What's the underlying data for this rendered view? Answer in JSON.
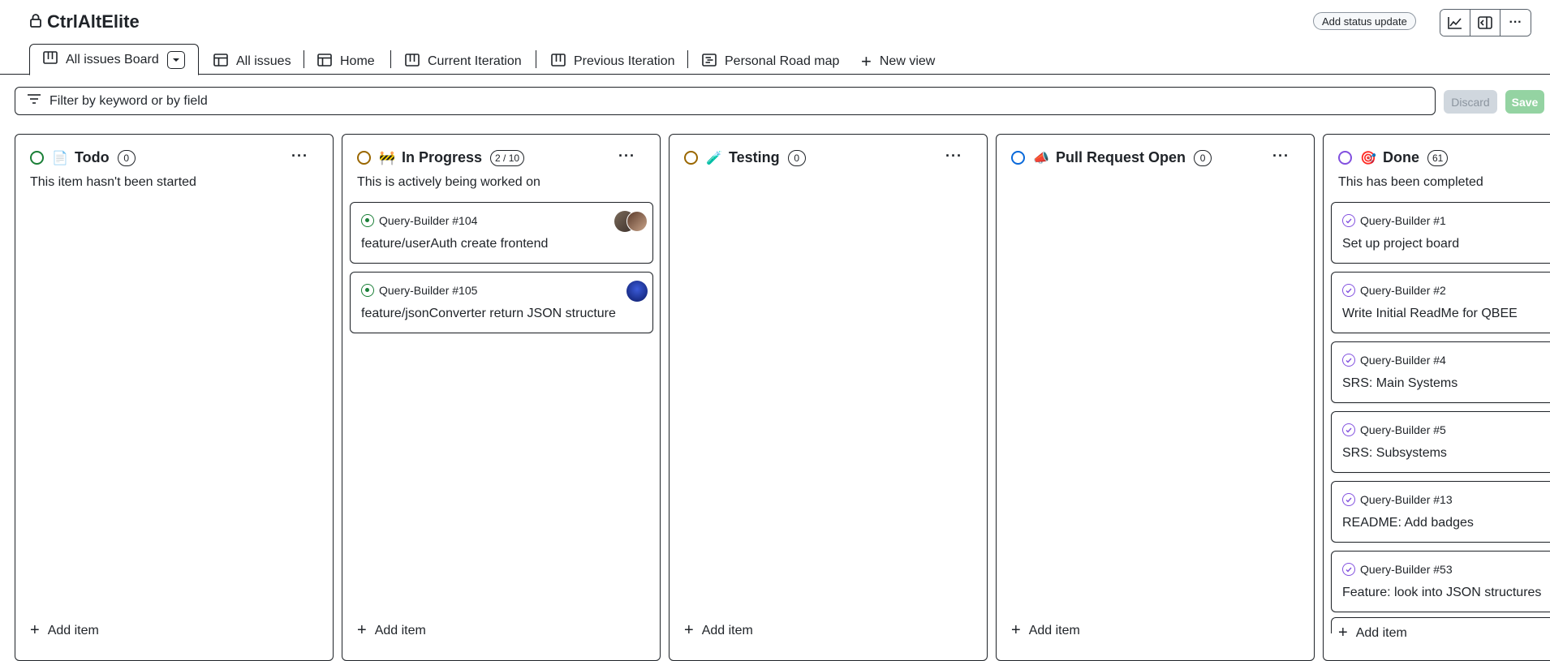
{
  "header": {
    "title": "CtrlAltElite",
    "status_button": "Add status update"
  },
  "tabs": [
    {
      "label": "All issues Board"
    },
    {
      "label": "All issues"
    },
    {
      "label": "Home"
    },
    {
      "label": "Current Iteration"
    },
    {
      "label": "Previous Iteration"
    },
    {
      "label": "Personal Road map"
    },
    {
      "label": "New view"
    }
  ],
  "filter": {
    "placeholder": "Filter by keyword or by field",
    "discard": "Discard",
    "save": "Save"
  },
  "columns": [
    {
      "title": "Todo",
      "icon": "memo-emoji",
      "count": "0",
      "ring_color": "#1a7f37",
      "description": "This item hasn't been started",
      "add_label": "Add item",
      "cards": []
    },
    {
      "title": "In Progress",
      "icon": "construction-emoji",
      "count": "2 / 10",
      "ring_color": "#9a6700",
      "description": "This is actively being worked on",
      "add_label": "Add item",
      "cards": [
        {
          "ref": "Query-Builder #104",
          "title": "feature/userAuth create frontend"
        },
        {
          "ref": "Query-Builder #105",
          "title": "feature/jsonConverter return JSON structure"
        }
      ]
    },
    {
      "title": "Testing",
      "icon": "test-tube-emoji",
      "count": "0",
      "ring_color": "#9a6700",
      "description": "",
      "add_label": "Add item",
      "cards": []
    },
    {
      "title": "Pull Request Open",
      "icon": "megaphone-emoji",
      "count": "0",
      "ring_color": "#0969da",
      "description": "",
      "add_label": "Add item",
      "cards": []
    },
    {
      "title": "Done",
      "icon": "target-emoji",
      "count": "61",
      "ring_color": "#8250df",
      "description": "This has been completed",
      "add_label": "Add item",
      "cards": [
        {
          "ref": "Query-Builder #1",
          "title": "Set up project board"
        },
        {
          "ref": "Query-Builder #2",
          "title": "Write Initial ReadMe for QBEE"
        },
        {
          "ref": "Query-Builder #4",
          "title": "SRS: Main Systems"
        },
        {
          "ref": "Query-Builder #5",
          "title": "SRS: Subsystems"
        },
        {
          "ref": "Query-Builder #13",
          "title": "README: Add badges"
        },
        {
          "ref": "Query-Builder #53",
          "title": "Feature: look into JSON structures"
        }
      ]
    }
  ]
}
